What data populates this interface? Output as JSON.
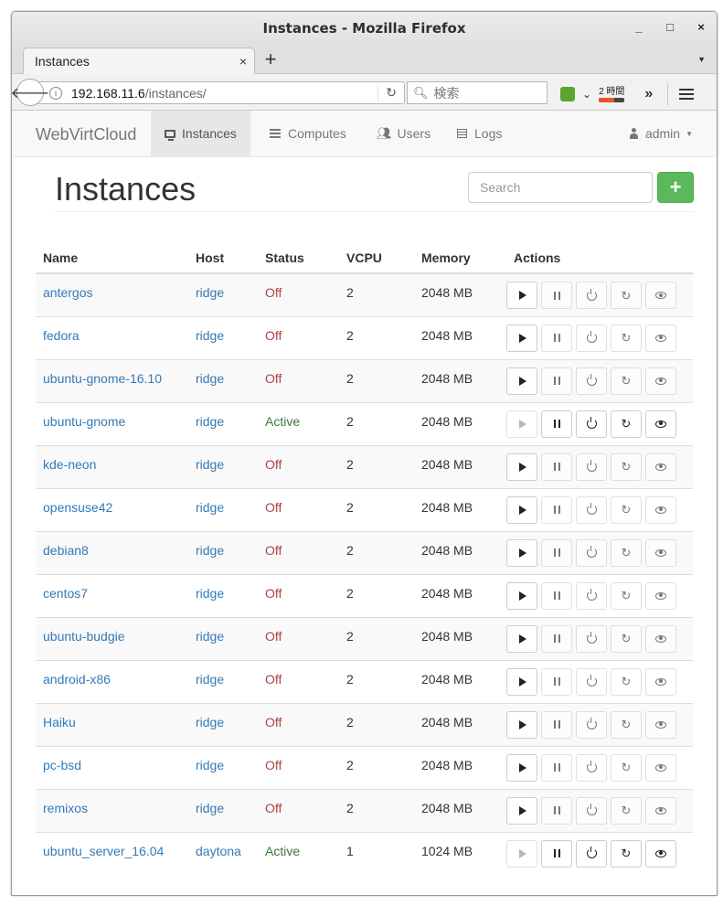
{
  "window": {
    "title": "Instances - Mozilla Firefox",
    "minimize": "_",
    "maximize": "□",
    "close": "×"
  },
  "tab": {
    "label": "Instances",
    "close": "×",
    "new_tab": "+"
  },
  "navbar": {
    "url_host": "192.168.11.6",
    "url_path": "/instances/",
    "search_placeholder": "検索",
    "timer_label": "2 時間",
    "timer_fraction": 0.6
  },
  "app": {
    "brand": "WebVirtCloud",
    "nav": [
      {
        "label": "Instances",
        "icon": "monitor-icon",
        "active": true
      },
      {
        "label": "Computes",
        "icon": "list-icon"
      },
      {
        "label": "Users",
        "icon": "users-icon"
      },
      {
        "label": "Logs",
        "icon": "document-icon"
      }
    ],
    "user": "admin"
  },
  "page": {
    "title": "Instances",
    "search_placeholder": "Search",
    "add_label": "+"
  },
  "table": {
    "headers": [
      "Name",
      "Host",
      "Status",
      "VCPU",
      "Memory",
      "Actions"
    ],
    "rows": [
      {
        "name": "antergos",
        "host": "ridge",
        "status": "Off",
        "vcpu": "2",
        "memory": "2048 MB"
      },
      {
        "name": "fedora",
        "host": "ridge",
        "status": "Off",
        "vcpu": "2",
        "memory": "2048 MB"
      },
      {
        "name": "ubuntu-gnome-16.10",
        "host": "ridge",
        "status": "Off",
        "vcpu": "2",
        "memory": "2048 MB"
      },
      {
        "name": "ubuntu-gnome",
        "host": "ridge",
        "status": "Active",
        "vcpu": "2",
        "memory": "2048 MB"
      },
      {
        "name": "kde-neon",
        "host": "ridge",
        "status": "Off",
        "vcpu": "2",
        "memory": "2048 MB"
      },
      {
        "name": "opensuse42",
        "host": "ridge",
        "status": "Off",
        "vcpu": "2",
        "memory": "2048 MB"
      },
      {
        "name": "debian8",
        "host": "ridge",
        "status": "Off",
        "vcpu": "2",
        "memory": "2048 MB"
      },
      {
        "name": "centos7",
        "host": "ridge",
        "status": "Off",
        "vcpu": "2",
        "memory": "2048 MB"
      },
      {
        "name": "ubuntu-budgie",
        "host": "ridge",
        "status": "Off",
        "vcpu": "2",
        "memory": "2048 MB"
      },
      {
        "name": "android-x86",
        "host": "ridge",
        "status": "Off",
        "vcpu": "2",
        "memory": "2048 MB"
      },
      {
        "name": "Haiku",
        "host": "ridge",
        "status": "Off",
        "vcpu": "2",
        "memory": "2048 MB"
      },
      {
        "name": "pc-bsd",
        "host": "ridge",
        "status": "Off",
        "vcpu": "2",
        "memory": "2048 MB"
      },
      {
        "name": "remixos",
        "host": "ridge",
        "status": "Off",
        "vcpu": "2",
        "memory": "2048 MB"
      },
      {
        "name": "ubuntu_server_16.04",
        "host": "daytona",
        "status": "Active",
        "vcpu": "1",
        "memory": "1024 MB"
      }
    ]
  },
  "colors": {
    "link": "#337ab7",
    "status_off": "#a94442",
    "status_active": "#3c763d",
    "add_button": "#5cb85c"
  }
}
